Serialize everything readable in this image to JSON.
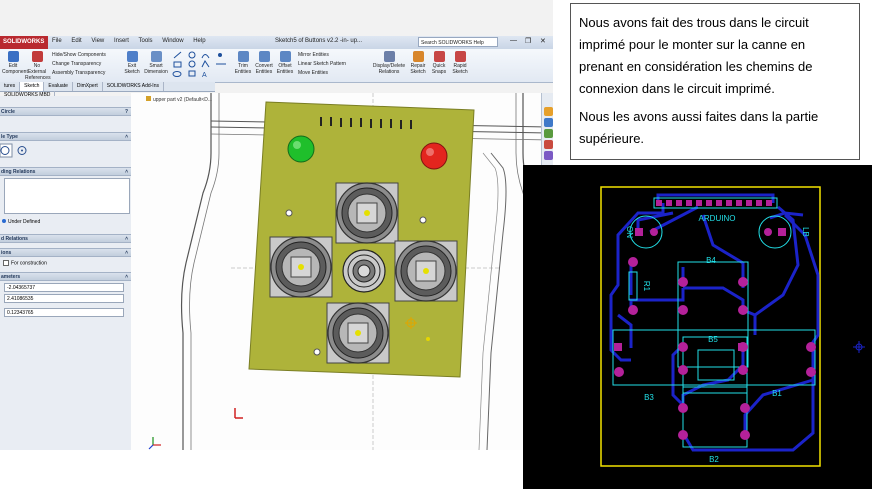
{
  "cad": {
    "app_name": "SOLIDWORKS",
    "menu": [
      "File",
      "Edit",
      "View",
      "Insert",
      "Tools",
      "Window",
      "Help"
    ],
    "document_title": "Sketch5 of Buttons v2.2 -in- up...",
    "help_search_placeholder": "Search SOLIDWORKS Help",
    "ribbon": {
      "edit_component": "Edit Component",
      "no_external_references": "No External References",
      "hide_show_components": "Hide/Show Components",
      "change_transparency": "Change Transparency",
      "assembly_transparency": "Assembly Transparency",
      "exit_sketch": "Exit Sketch",
      "smart_dimension": "Smart Dimension",
      "trim_entities": "Trim Entities",
      "convert_entities": "Convert Entities",
      "offset_entities": "Offset Entities",
      "mirror_entities": "Mirror Entities",
      "linear_sketch_pattern": "Linear Sketch Pattern",
      "move_entities": "Move Entities",
      "display_delete_relations": "Display/Delete Relations",
      "repair_sketch": "Repair Sketch",
      "quick_snaps": "Quick Snaps",
      "rapid_sketch": "Rapid Sketch"
    },
    "tabs": [
      "tures",
      "Sketch",
      "Evaluate",
      "DimXpert",
      "SOLIDWORKS Add-Ins",
      "SOLIDWORKS MBD"
    ],
    "active_tab": "Sketch",
    "breadcrumb": "upper part v2 (Default<D...",
    "property_manager": {
      "title": "Circle",
      "circle_type_header": "le Type",
      "relations_header": "ding Relations",
      "under_defined": "Under Defined",
      "add_relations_header": "d Relations",
      "options_header": "ions",
      "for_construction": "For construction",
      "parameters_header": "ameters",
      "param_x": "-2.04365737",
      "param_y": "2.41086535",
      "param_r": "0.12343765"
    },
    "colors": {
      "board": "#aeb33a",
      "led_green": "#1fbf2b",
      "led_red": "#e3251e"
    }
  },
  "note": {
    "paragraph1": "Nous avons fait des trous dans le circuit imprimé pour le monter sur la canne en prenant en considération les chemins de connexion dans le circuit imprimé.",
    "paragraph2": "Nous les avons aussi faites dans la partie supérieure."
  },
  "pcb": {
    "labels": {
      "arduino": "ARDUINO",
      "on": "ON",
      "lb": "LB",
      "r1": "R1",
      "b1": "B1",
      "b2": "B2",
      "b3": "B3",
      "b4": "B4",
      "b5": "B5"
    },
    "colors": {
      "background": "#000000",
      "outline": "#f2e200",
      "trace": "#1b23c9",
      "silkscreen": "#22e0e8",
      "pad": "#b4219a"
    }
  }
}
